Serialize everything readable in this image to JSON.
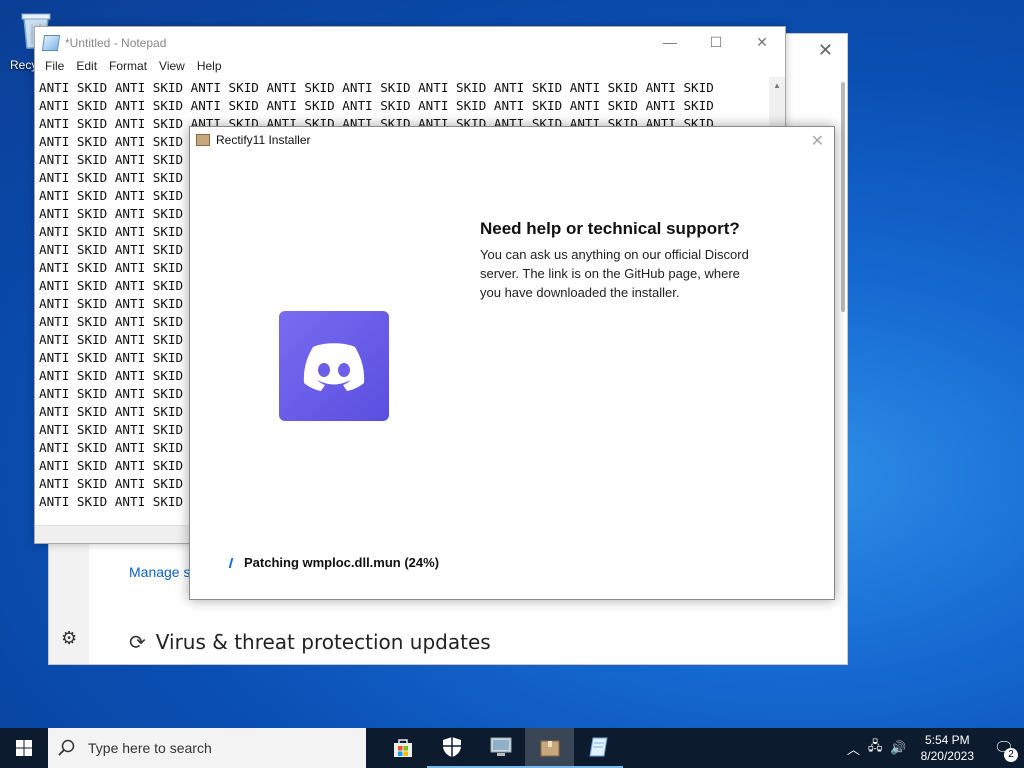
{
  "desktop": {
    "recycle_label": "Recy"
  },
  "security_window": {
    "manage_link": "Manage s",
    "section_title": "Virus & threat protection updates",
    "icons": [
      "close-icon",
      "gear-icon",
      "refresh-icon"
    ]
  },
  "notepad": {
    "title": "*Untitled - Notepad",
    "menu": [
      "File",
      "Edit",
      "Format",
      "View",
      "Help"
    ],
    "window_buttons": [
      "minimize",
      "maximize",
      "close"
    ],
    "lines": [
      "ANTI SKID ANTI SKID ANTI SKID ANTI SKID ANTI SKID ANTI SKID ANTI SKID ANTI SKID ANTI SKID",
      "ANTI SKID ANTI SKID ANTI SKID ANTI SKID ANTI SKID ANTI SKID ANTI SKID ANTI SKID ANTI SKID",
      "ANTI SKID ANTI SKID ANTI SKID ANTI SKID ANTI SKID ANTI SKID ANTI SKID ANTI SKID ANTI SKID",
      "ANTI SKID ANTI SKID",
      "ANTI SKID ANTI SKID",
      "ANTI SKID ANTI SKID",
      "ANTI SKID ANTI SKID",
      "ANTI SKID ANTI SKID",
      "ANTI SKID ANTI SKID",
      "ANTI SKID ANTI SKID",
      "ANTI SKID ANTI SKID",
      "ANTI SKID ANTI SKID",
      "ANTI SKID ANTI SKID",
      "ANTI SKID ANTI SKID",
      "ANTI SKID ANTI SKID",
      "ANTI SKID ANTI SKID",
      "ANTI SKID ANTI SKID",
      "ANTI SKID ANTI SKID",
      "ANTI SKID ANTI SKID",
      "ANTI SKID ANTI SKID",
      "ANTI SKID ANTI SKID",
      "ANTI SKID ANTI SKID",
      "ANTI SKID ANTI SKID",
      "ANTI SKID ANTI SKID"
    ]
  },
  "installer": {
    "title": "Rectify11 Installer",
    "heading": "Need help or technical support?",
    "body": "You can ask us anything on our official Discord server. The link is on the GitHub page, where you have downloaded the installer.",
    "status": "Patching wmploc.dll.mun (24%)",
    "brand_color": "#5865F2"
  },
  "taskbar": {
    "search_placeholder": "Type here to search",
    "apps": [
      "store-icon",
      "security-icon",
      "computer-icon",
      "installer-icon",
      "notepad-icon"
    ],
    "time": "5:54 PM",
    "date": "8/20/2023",
    "notification_count": "2"
  }
}
